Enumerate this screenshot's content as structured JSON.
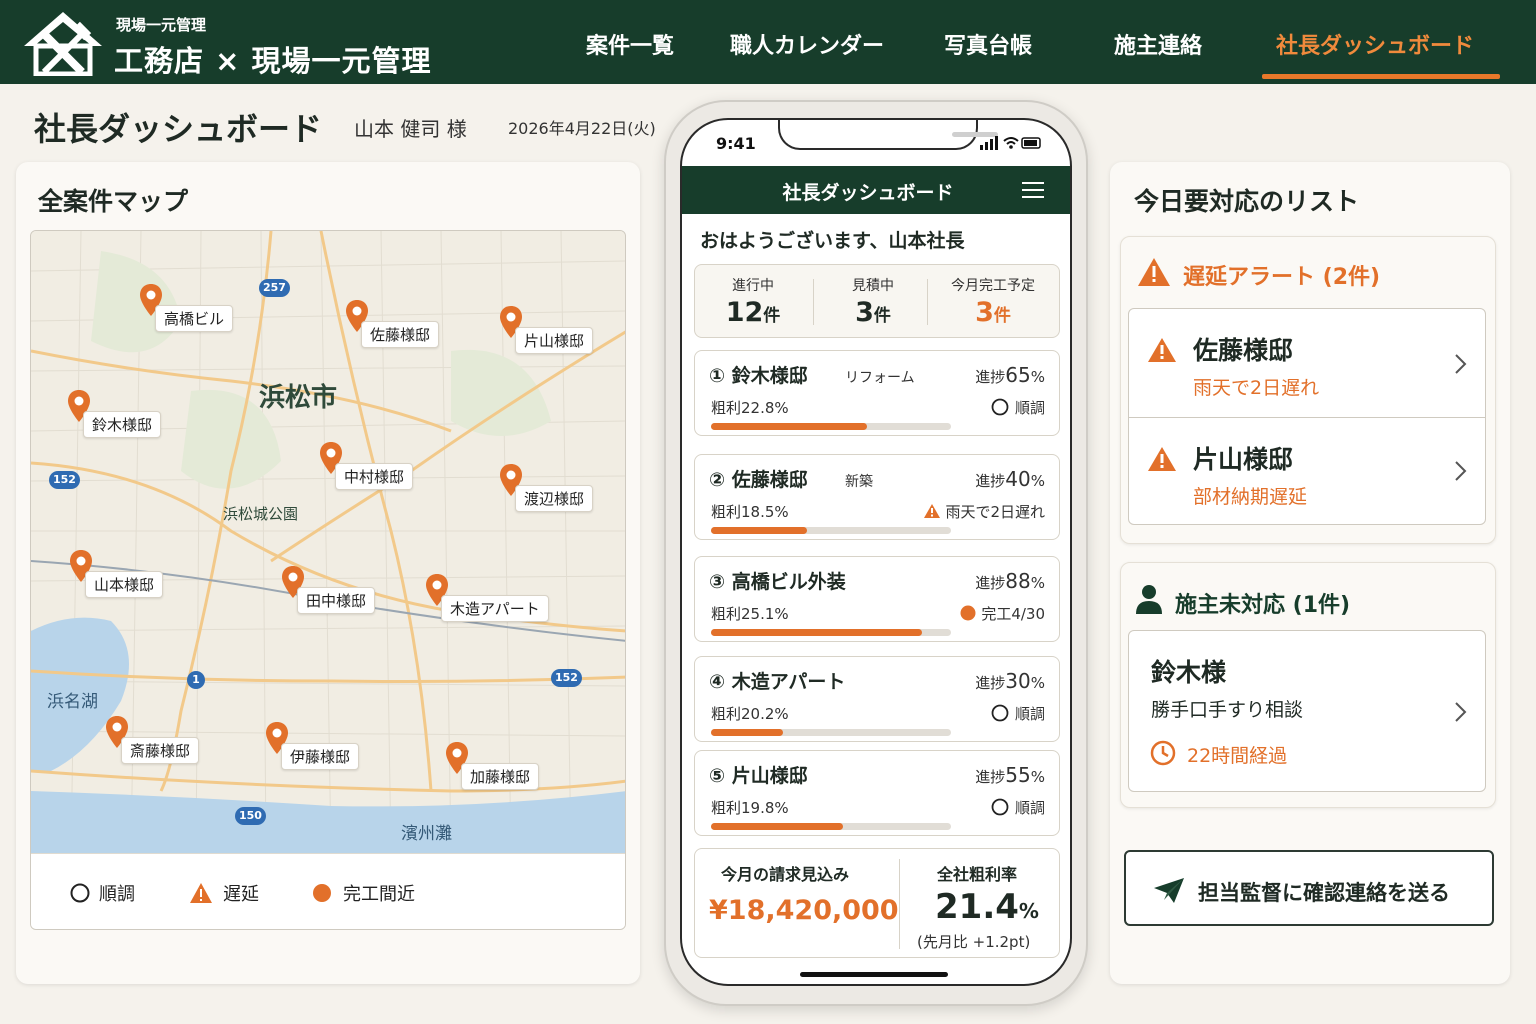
{
  "header": {
    "brand_small": "現場一元管理",
    "brand_big": "工務店 × 現場一元管理",
    "nav": [
      "案件一覧",
      "職人カレンダー",
      "写真台帳",
      "施主連絡",
      "社長ダッシュボード"
    ],
    "active_nav": "社長ダッシュボード"
  },
  "page": {
    "title": "社長ダッシュボード",
    "user": "山本 健司 様",
    "date": "2026年4月22日(火)"
  },
  "map_panel": {
    "title": "全案件マップ",
    "city_label": "浜松市",
    "park_label": "浜松城公園",
    "lake_label": "浜名湖",
    "sea_label": "濱州灘",
    "routes": [
      "257",
      "152",
      "152",
      "1",
      "150"
    ],
    "pins": [
      "高橋ビル",
      "佐藤様邸",
      "片山様邸",
      "鈴木様邸",
      "中村様邸",
      "渡辺様邸",
      "山本様邸",
      "田中様邸",
      "木造アパート",
      "斎藤様邸",
      "伊藤様邸",
      "加藤様邸"
    ],
    "legend": [
      "順調",
      "遅延",
      "完工間近"
    ]
  },
  "phone": {
    "status_time": "9:41",
    "app_title": "社長ダッシュボード",
    "greeting": "おはようございます、山本社長",
    "stats": [
      {
        "label": "進行中",
        "value": "12",
        "unit": "件"
      },
      {
        "label": "見積中",
        "value": "3",
        "unit": "件"
      },
      {
        "label": "今月完工予定",
        "value": "3",
        "unit": "件"
      }
    ],
    "projects": [
      {
        "name": "① 鈴木様邸",
        "tag": "リフォーム",
        "progress_label": "進捗",
        "progress": "65",
        "margin": "粗利22.8%",
        "status": "順調",
        "status_type": "ok",
        "fill": 0.65
      },
      {
        "name": "② 佐藤様邸",
        "tag": "新築",
        "progress_label": "進捗",
        "progress": "40",
        "margin": "粗利18.5%",
        "status": "雨天で2日遅れ",
        "status_type": "delay",
        "fill": 0.4
      },
      {
        "name": "③ 高橋ビル外装",
        "tag": "",
        "progress_label": "進捗",
        "progress": "88",
        "margin": "粗利25.1%",
        "status": "完工4/30",
        "status_type": "done",
        "fill": 0.88
      },
      {
        "name": "④ 木造アパート",
        "tag": "",
        "progress_label": "進捗",
        "progress": "30",
        "margin": "粗利20.2%",
        "status": "順調",
        "status_type": "ok",
        "fill": 0.3
      },
      {
        "name": "⑤ 片山様邸",
        "tag": "",
        "progress_label": "進捗",
        "progress": "55",
        "margin": "粗利19.8%",
        "status": "順調",
        "status_type": "ok",
        "fill": 0.55
      }
    ],
    "summary": {
      "billing_label": "今月の請求見込み",
      "billing_amount": "¥18,420,000",
      "rate_label": "全社粗利率",
      "rate_value": "21.4",
      "rate_unit": "%",
      "rate_sub": "(先月比 +1.2pt)"
    }
  },
  "right_panel": {
    "title": "今日要対応のリスト",
    "delay_title": "遅延アラート (2件)",
    "delay_items": [
      {
        "name": "佐藤様邸",
        "detail": "雨天で2日遅れ"
      },
      {
        "name": "片山様邸",
        "detail": "部材納期遅延"
      }
    ],
    "owner_title": "施主未対応 (1件)",
    "owner_item": {
      "name": "鈴木様",
      "detail": "勝手口手すり相談",
      "elapsed": "22時間経過"
    },
    "send_button": "担当監督に確認連絡を送る"
  },
  "colors": {
    "brand_green": "#173d2b",
    "accent_orange": "#e2702a"
  }
}
